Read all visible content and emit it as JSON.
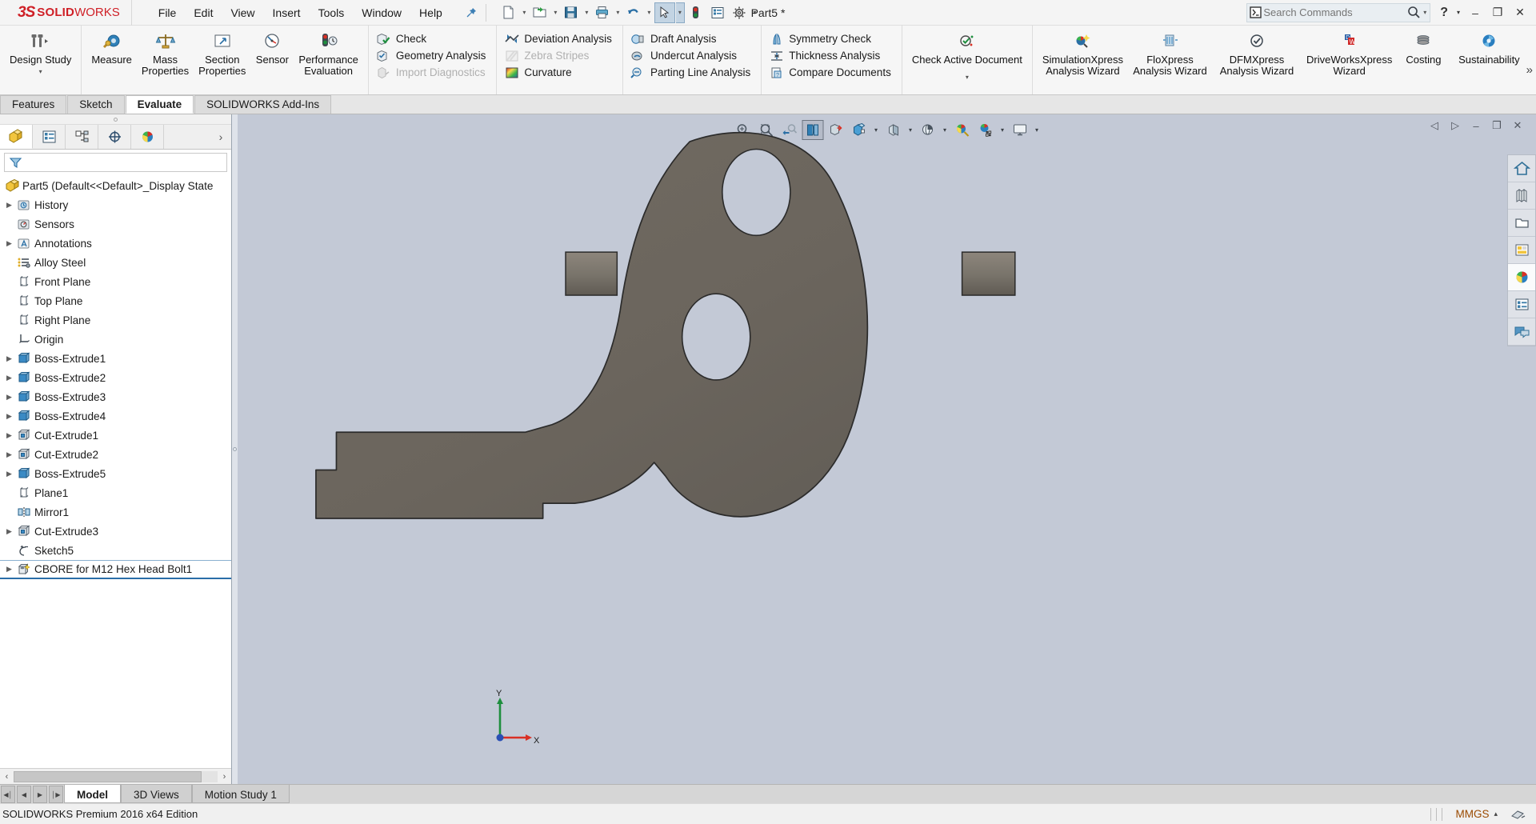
{
  "app": {
    "brand_ds": "3S",
    "brand_solid": "SOLID",
    "brand_works": "WORKS",
    "document_title": "Part5 *",
    "accent_red": "#cf1f26",
    "graphics_bg": "#c3c9d6",
    "model_fill": "#6b655d"
  },
  "menubar": {
    "items": [
      {
        "label": "File"
      },
      {
        "label": "Edit"
      },
      {
        "label": "View"
      },
      {
        "label": "Insert"
      },
      {
        "label": "Tools"
      },
      {
        "label": "Window"
      },
      {
        "label": "Help"
      }
    ]
  },
  "quick_access": {
    "buttons": [
      {
        "name": "new-document",
        "has_dropdown": true
      },
      {
        "name": "open-document",
        "has_dropdown": true
      },
      {
        "name": "save-document",
        "has_dropdown": true
      },
      {
        "name": "print-document",
        "has_dropdown": true
      },
      {
        "name": "undo",
        "has_dropdown": true
      },
      {
        "name": "select-pointer",
        "has_dropdown": true,
        "selected": true
      },
      {
        "name": "rebuild",
        "has_dropdown": false
      },
      {
        "name": "file-properties",
        "has_dropdown": false
      },
      {
        "name": "options",
        "has_dropdown": true
      }
    ]
  },
  "search": {
    "placeholder": "Search Commands",
    "value": ""
  },
  "window_controls": {
    "help": "?",
    "minimize": "–",
    "restore": "❐",
    "close": "✕"
  },
  "ribbon": {
    "groups": [
      {
        "name": "design-study",
        "type": "big",
        "buttons": [
          {
            "label": "Design Study",
            "icon": "design-study-icon",
            "dropdown": true
          }
        ]
      },
      {
        "name": "evaluate-tools",
        "type": "big",
        "buttons": [
          {
            "label": "Measure",
            "icon": "measure-icon"
          },
          {
            "label": "Mass\nProperties",
            "icon": "mass-properties-icon"
          },
          {
            "label": "Section\nProperties",
            "icon": "section-properties-icon"
          },
          {
            "label": "Sensor",
            "icon": "sensor-icon"
          },
          {
            "label": "Performance\nEvaluation",
            "icon": "performance-evaluation-icon"
          }
        ]
      },
      {
        "name": "check-column",
        "type": "small",
        "items": [
          {
            "label": "Check",
            "icon": "check-icon",
            "disabled": false
          },
          {
            "label": "Geometry Analysis",
            "icon": "geometry-analysis-icon",
            "disabled": false
          },
          {
            "label": "Import Diagnostics",
            "icon": "import-diagnostics-icon",
            "disabled": true
          }
        ]
      },
      {
        "name": "deviation-column",
        "type": "small",
        "items": [
          {
            "label": "Deviation Analysis",
            "icon": "deviation-analysis-icon",
            "disabled": false
          },
          {
            "label": "Zebra Stripes",
            "icon": "zebra-stripes-icon",
            "disabled": true
          },
          {
            "label": "Curvature",
            "icon": "curvature-icon",
            "disabled": false
          }
        ]
      },
      {
        "name": "draft-column",
        "type": "small",
        "items": [
          {
            "label": "Draft Analysis",
            "icon": "draft-analysis-icon",
            "disabled": false
          },
          {
            "label": "Undercut Analysis",
            "icon": "undercut-analysis-icon",
            "disabled": false
          },
          {
            "label": "Parting Line Analysis",
            "icon": "parting-line-analysis-icon",
            "disabled": false
          }
        ]
      },
      {
        "name": "symmetry-column",
        "type": "small",
        "items": [
          {
            "label": "Symmetry Check",
            "icon": "symmetry-check-icon",
            "disabled": false
          },
          {
            "label": "Thickness Analysis",
            "icon": "thickness-analysis-icon",
            "disabled": false
          },
          {
            "label": "Compare Documents",
            "icon": "compare-documents-icon",
            "disabled": false
          }
        ]
      },
      {
        "name": "check-active",
        "type": "big",
        "buttons": [
          {
            "label": "Check Active Document",
            "icon": "check-active-document-icon",
            "dropdown": true
          }
        ]
      },
      {
        "name": "xpress-wizards",
        "type": "big",
        "buttons": [
          {
            "label": "SimulationXpress\nAnalysis Wizard",
            "icon": "simulationxpress-icon"
          },
          {
            "label": "FloXpress\nAnalysis Wizard",
            "icon": "floxpress-icon"
          },
          {
            "label": "DFMXpress\nAnalysis Wizard",
            "icon": "dfmxpress-icon"
          },
          {
            "label": "DriveWorksXpress\nWizard",
            "icon": "driveworksxpress-icon"
          },
          {
            "label": "Costing",
            "icon": "costing-icon"
          },
          {
            "label": "Sustainability",
            "icon": "sustainability-icon"
          }
        ]
      }
    ],
    "more_chevron": "»"
  },
  "command_tabs": {
    "items": [
      {
        "label": "Features",
        "active": false
      },
      {
        "label": "Sketch",
        "active": false
      },
      {
        "label": "Evaluate",
        "active": true
      },
      {
        "label": "SOLIDWORKS Add-Ins",
        "active": false
      }
    ]
  },
  "panel_tabs": {
    "items": [
      {
        "name": "feature-manager-tab",
        "icon": "yellow-part-icon",
        "active": true
      },
      {
        "name": "property-manager-tab",
        "icon": "property-list-icon",
        "active": false
      },
      {
        "name": "configuration-manager-tab",
        "icon": "configuration-icon",
        "active": false
      },
      {
        "name": "dimxpert-manager-tab",
        "icon": "dimxpert-icon",
        "active": false
      },
      {
        "name": "display-manager-tab",
        "icon": "display-sphere-icon",
        "active": false
      }
    ],
    "expand_chevron": "›"
  },
  "filter": {
    "placeholder": "",
    "value": "",
    "icon": "filter-funnel-icon"
  },
  "feature_tree": {
    "root": {
      "label": "Part5  (Default<<Default>_Display State",
      "icon": "part-icon"
    },
    "nodes": [
      {
        "label": "History",
        "icon": "history-icon",
        "expandable": true,
        "indent": 1
      },
      {
        "label": "Sensors",
        "icon": "sensors-icon",
        "expandable": false,
        "indent": 1
      },
      {
        "label": "Annotations",
        "icon": "annotations-icon",
        "expandable": true,
        "indent": 1
      },
      {
        "label": "Alloy Steel",
        "icon": "material-icon",
        "expandable": false,
        "indent": 1
      },
      {
        "label": "Front Plane",
        "icon": "plane-icon",
        "expandable": false,
        "indent": 1
      },
      {
        "label": "Top Plane",
        "icon": "plane-icon",
        "expandable": false,
        "indent": 1
      },
      {
        "label": "Right Plane",
        "icon": "plane-icon",
        "expandable": false,
        "indent": 1
      },
      {
        "label": "Origin",
        "icon": "origin-icon",
        "expandable": false,
        "indent": 1
      },
      {
        "label": "Boss-Extrude1",
        "icon": "boss-extrude-icon",
        "expandable": true,
        "indent": 1
      },
      {
        "label": "Boss-Extrude2",
        "icon": "boss-extrude-icon",
        "expandable": true,
        "indent": 1
      },
      {
        "label": "Boss-Extrude3",
        "icon": "boss-extrude-icon",
        "expandable": true,
        "indent": 1
      },
      {
        "label": "Boss-Extrude4",
        "icon": "boss-extrude-icon",
        "expandable": true,
        "indent": 1
      },
      {
        "label": "Cut-Extrude1",
        "icon": "cut-extrude-icon",
        "expandable": true,
        "indent": 1
      },
      {
        "label": "Cut-Extrude2",
        "icon": "cut-extrude-icon",
        "expandable": true,
        "indent": 1
      },
      {
        "label": "Boss-Extrude5",
        "icon": "boss-extrude-icon",
        "expandable": true,
        "indent": 1
      },
      {
        "label": "Plane1",
        "icon": "plane-icon",
        "expandable": false,
        "indent": 1
      },
      {
        "label": "Mirror1",
        "icon": "mirror-icon",
        "expandable": false,
        "indent": 1
      },
      {
        "label": "Cut-Extrude3",
        "icon": "cut-extrude-icon",
        "expandable": true,
        "indent": 1
      },
      {
        "label": "Sketch5",
        "icon": "sketch-icon",
        "expandable": false,
        "indent": 1
      },
      {
        "label": "CBORE for M12 Hex Head Bolt1",
        "icon": "hole-wizard-icon",
        "expandable": true,
        "indent": 1,
        "selected": true
      }
    ]
  },
  "heads_up_toolbar": {
    "buttons": [
      {
        "name": "zoom-to-fit-icon",
        "dropdown": false,
        "active": false
      },
      {
        "name": "zoom-to-area-icon",
        "dropdown": false,
        "active": false
      },
      {
        "name": "previous-view-icon",
        "dropdown": false,
        "active": false
      },
      {
        "name": "section-view-icon",
        "dropdown": false,
        "active": true
      },
      {
        "name": "view-orientation-icon",
        "dropdown": false,
        "active": false
      },
      {
        "name": "display-style-icon",
        "dropdown": true,
        "active": false
      },
      {
        "name": "hide-show-items-icon",
        "dropdown": true,
        "active": false
      },
      {
        "name": "edit-appearance-icon",
        "dropdown": false,
        "active": false
      },
      {
        "name": "apply-scene-icon",
        "dropdown": true,
        "active": false
      },
      {
        "name": "view-settings-icon",
        "dropdown": true,
        "active": false
      }
    ]
  },
  "doc_window_controls": {
    "prev": "◁",
    "next": "▷",
    "minimize": "–",
    "restore": "❐",
    "close": "✕"
  },
  "right_dock": {
    "items": [
      {
        "name": "home-icon",
        "active": false
      },
      {
        "name": "design-library-icon",
        "active": false
      },
      {
        "name": "file-explorer-icon",
        "active": false
      },
      {
        "name": "view-palette-icon",
        "active": false
      },
      {
        "name": "appearances-scenes-icon",
        "active": true
      },
      {
        "name": "custom-properties-icon",
        "active": false
      },
      {
        "name": "solidworks-forum-icon",
        "active": false
      }
    ]
  },
  "triad": {
    "y_label": "Y",
    "x_label": "X"
  },
  "bottom_tabs": {
    "nav": [
      {
        "name": "first-tab-button",
        "glyph": "◀│"
      },
      {
        "name": "prev-tab-button",
        "glyph": "◀"
      },
      {
        "name": "next-tab-button",
        "glyph": "▶"
      },
      {
        "name": "last-tab-button",
        "glyph": "│▶"
      }
    ],
    "tabs": [
      {
        "label": "Model",
        "active": true
      },
      {
        "label": "3D Views",
        "active": false
      },
      {
        "label": "Motion Study 1",
        "active": false
      }
    ]
  },
  "status_bar": {
    "message": "SOLIDWORKS Premium 2016 x64 Edition",
    "units": "MMGS",
    "units_arrow": "▴",
    "overlay_icon": "editing-part-icon"
  },
  "h_scroll": {
    "left_arrow": "‹",
    "right_arrow": "›"
  }
}
